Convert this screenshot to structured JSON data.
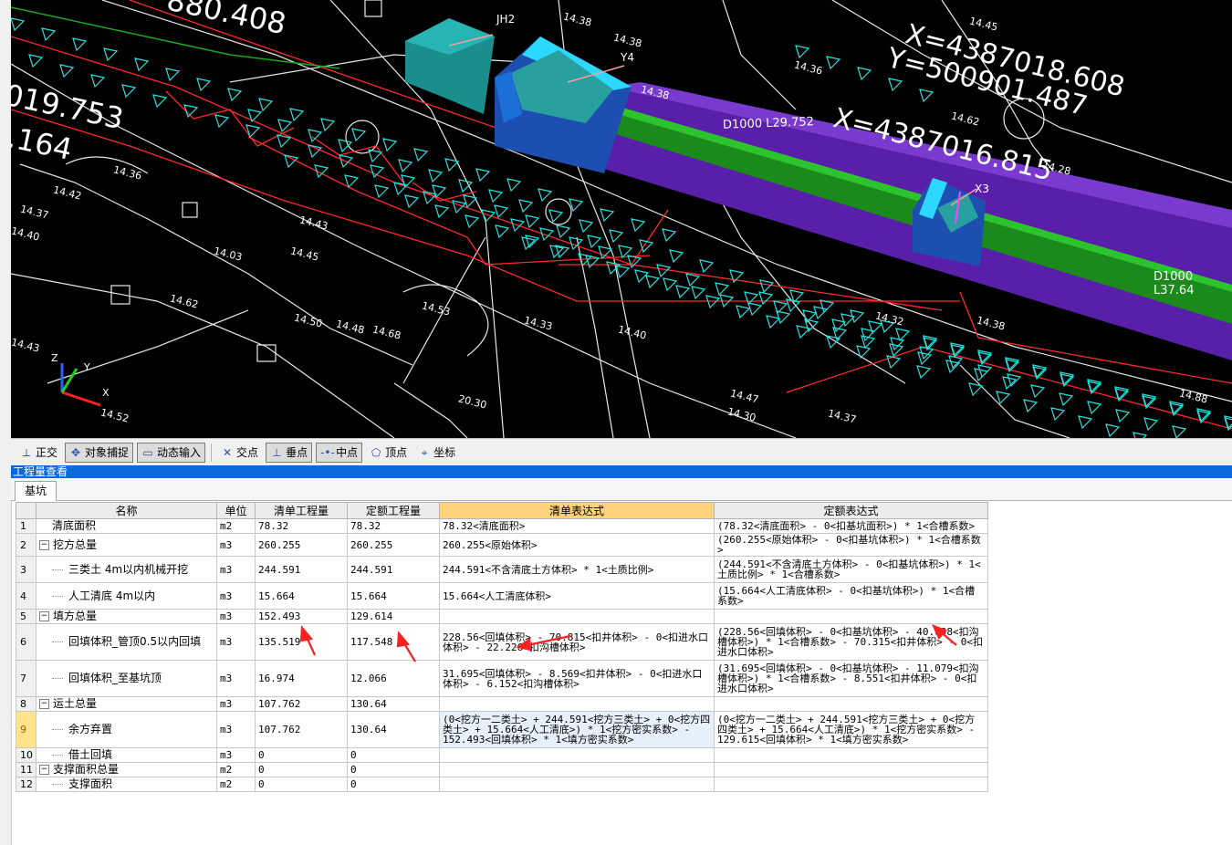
{
  "cad": {
    "labels": {
      "coord_x1": "X=4387018.608",
      "coord_y1": "Y=500901.487",
      "coord_x2": "X=4387016.815",
      "coord_partial1": "880.408",
      "coord_partial2": "019.753",
      "coord_partial3": ".164",
      "well_jh2": "JH2",
      "well_y4": "Y4",
      "well_x3": "X3",
      "pipe1": "D1000 L29.752",
      "pipe2": "D1000 L37.64",
      "axis_x": "X",
      "axis_y": "Y",
      "axis_z": "Z"
    },
    "elevations": [
      "14.38",
      "14.38",
      "14.36",
      "14.45",
      "14.62",
      "14.28",
      "14.38",
      "14.36",
      "14.42",
      "14.37",
      "14.40",
      "14.43",
      "14.03",
      "14.45",
      "14.53",
      "14.48",
      "14.68",
      "14.50",
      "14.33",
      "14.40",
      "14.38",
      "14.32",
      "14.47",
      "14.30",
      "14.37",
      "14.88",
      "14.52",
      "20.30",
      "14.62",
      "14.43"
    ]
  },
  "snapbar": {
    "items": [
      {
        "label": "正交",
        "icon": "orthogonal-icon",
        "on": false
      },
      {
        "label": "对象捕捉",
        "icon": "object-snap-icon",
        "on": true
      },
      {
        "label": "动态输入",
        "icon": "dynamic-input-icon",
        "on": true
      },
      {
        "label": "交点",
        "icon": "intersection-icon",
        "on": false
      },
      {
        "label": "垂点",
        "icon": "perpendicular-icon",
        "on": true
      },
      {
        "label": "中点",
        "icon": "midpoint-icon",
        "on": true
      },
      {
        "label": "顶点",
        "icon": "vertex-icon",
        "on": false
      },
      {
        "label": "坐标",
        "icon": "coordinate-icon",
        "on": false
      }
    ]
  },
  "panel": {
    "title": "工程量查看",
    "tab": "基坑"
  },
  "table": {
    "headers": [
      "名称",
      "单位",
      "清单工程量",
      "定额工程量",
      "清单表达式",
      "定额表达式"
    ],
    "rows": [
      {
        "n": "1",
        "name": "清底面积",
        "level": 0,
        "toggle": "",
        "unit": "m2",
        "q1": "78.32",
        "q2": "78.32",
        "e1": "78.32<清底面积>",
        "e2": "(78.32<清底面积> - 0<扣基坑面积>) * 1<合槽系数>"
      },
      {
        "n": "2",
        "name": "挖方总量",
        "level": 0,
        "toggle": "−",
        "unit": "m3",
        "q1": "260.255",
        "q2": "260.255",
        "e1": "260.255<原始体积>",
        "e2": "(260.255<原始体积> - 0<扣基坑体积>) * 1<合槽系数>"
      },
      {
        "n": "3",
        "name": "三类土 4m以内机械开挖",
        "level": 1,
        "toggle": "",
        "unit": "m3",
        "q1": "244.591",
        "q2": "244.591",
        "e1": "244.591<不含清底土方体积> * 1<土质比例>",
        "e2": "(244.591<不含清底土方体积> - 0<扣基坑体积>) * 1<土质比例> * 1<合槽系数>"
      },
      {
        "n": "4",
        "name": "人工清底 4m以内",
        "level": 1,
        "toggle": "",
        "unit": "m3",
        "q1": "15.664",
        "q2": "15.664",
        "e1": "15.664<人工清底体积>",
        "e2": "(15.664<人工清底体积> - 0<扣基坑体积>) * 1<合槽系数>"
      },
      {
        "n": "5",
        "name": "填方总量",
        "level": 0,
        "toggle": "−",
        "unit": "m3",
        "q1": "152.493",
        "q2": "129.614",
        "e1": "",
        "e2": ""
      },
      {
        "n": "6",
        "name": "回填体积_管顶0.5以内回填",
        "level": 1,
        "toggle": "",
        "unit": "m3",
        "q1": "135.519",
        "q2": "117.548",
        "e1": "228.56<回填体积> - 70.815<扣井体积> - 0<扣进水口体积> - 22.226<扣沟槽体积>",
        "e2": "(228.56<回填体积> - 0<扣基坑体积> - 40.698<扣沟槽体积>) * 1<合槽系数> - 70.315<扣井体积> - 0<扣进水口体积>"
      },
      {
        "n": "7",
        "name": "回填体积_至基坑顶",
        "level": 1,
        "toggle": "",
        "unit": "m3",
        "q1": "16.974",
        "q2": "12.066",
        "e1": "31.695<回填体积> - 8.569<扣井体积> - 0<扣进水口体积> - 6.152<扣沟槽体积>",
        "e2": "(31.695<回填体积> - 0<扣基坑体积> - 11.079<扣沟槽体积>) * 1<合槽系数> - 8.551<扣井体积> - 0<扣进水口体积>"
      },
      {
        "n": "8",
        "name": "运土总量",
        "level": 0,
        "toggle": "−",
        "unit": "m3",
        "q1": "107.762",
        "q2": "130.64",
        "e1": "",
        "e2": ""
      },
      {
        "n": "9",
        "name": "余方弃置",
        "level": 1,
        "toggle": "",
        "unit": "m3",
        "q1": "107.762",
        "q2": "130.64",
        "e1": "(0<挖方一二类土> + 244.591<挖方三类土> + 0<挖方四类土> + 15.664<人工清底>) * 1<挖方密实系数> - 152.493<回填体积> * 1<填方密实系数>",
        "e2": "(0<挖方一二类土> + 244.591<挖方三类土> + 0<挖方四类土> + 15.664<人工清底>) * 1<挖方密实系数> - 129.615<回填体积> * 1<填方密实系数>",
        "selected": true
      },
      {
        "n": "10",
        "name": "借土回填",
        "level": 1,
        "toggle": "",
        "unit": "m3",
        "q1": "0",
        "q2": "0",
        "e1": "",
        "e2": ""
      },
      {
        "n": "11",
        "name": "支撑面积总量",
        "level": 0,
        "toggle": "−",
        "unit": "m2",
        "q1": "0",
        "q2": "0",
        "e1": "",
        "e2": ""
      },
      {
        "n": "12",
        "name": "支撑面积",
        "level": 1,
        "toggle": "",
        "unit": "m2",
        "q1": "0",
        "q2": "0",
        "e1": "",
        "e2": ""
      }
    ]
  }
}
